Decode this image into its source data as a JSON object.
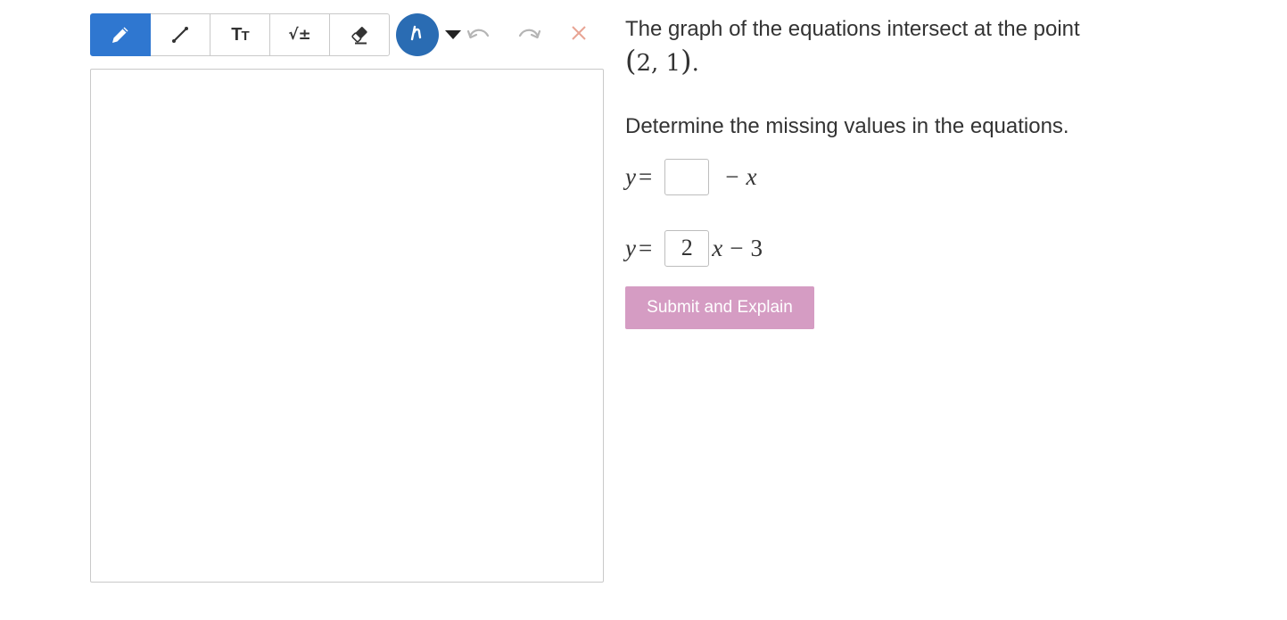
{
  "toolbar": {
    "tools": [
      {
        "name": "pencil",
        "icon": "pencil-icon",
        "active": true
      },
      {
        "name": "line",
        "icon": "line-icon",
        "active": false
      },
      {
        "name": "text",
        "icon": "text-size-icon",
        "label": "TT",
        "active": false
      },
      {
        "name": "math",
        "icon": "math-icon",
        "label": "√±",
        "active": false
      },
      {
        "name": "eraser",
        "icon": "eraser-icon",
        "active": false
      }
    ],
    "pen_color": "#2a6cb3",
    "active_color": "#2f77d0",
    "undo_icon": "undo-icon",
    "redo_icon": "redo-icon",
    "clear_icon": "close-icon",
    "clear_color": "#e8a494"
  },
  "question": {
    "prompt": "The graph of the equations intersect at the point",
    "point_open": "(",
    "point_values": "2, 1",
    "point_close": ")",
    "point_period": ".",
    "instruction": "Determine the missing values in the equations.",
    "equation1": {
      "lhs": "y",
      "equals": "=",
      "input_value": "",
      "minus": "−",
      "var": "x"
    },
    "equation2": {
      "lhs": "y",
      "equals": "=",
      "input_value": "2",
      "var": "x",
      "minus": "−",
      "constant": "3"
    },
    "submit_label": "Submit and Explain",
    "submit_color": "#d59cc3"
  }
}
